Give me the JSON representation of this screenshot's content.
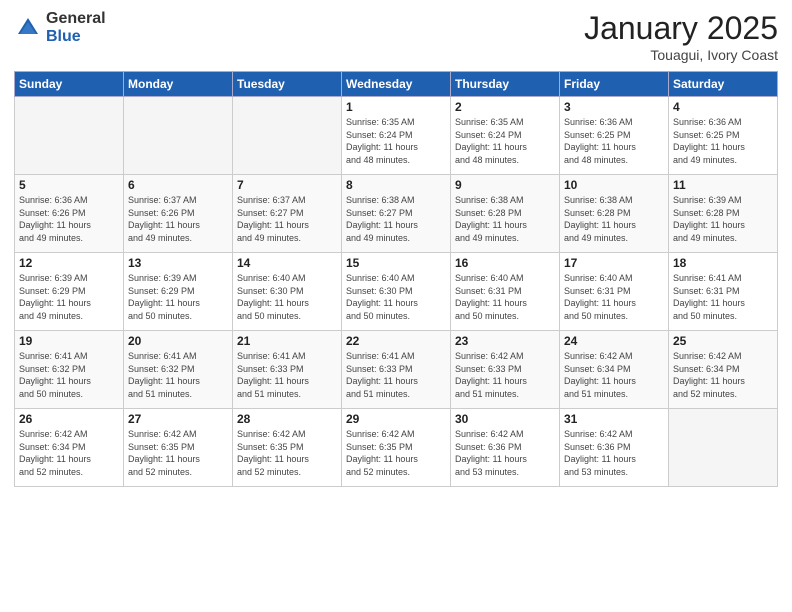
{
  "logo": {
    "general": "General",
    "blue": "Blue"
  },
  "header": {
    "month": "January 2025",
    "location": "Touagui, Ivory Coast"
  },
  "weekdays": [
    "Sunday",
    "Monday",
    "Tuesday",
    "Wednesday",
    "Thursday",
    "Friday",
    "Saturday"
  ],
  "weeks": [
    [
      {
        "day": "",
        "info": ""
      },
      {
        "day": "",
        "info": ""
      },
      {
        "day": "",
        "info": ""
      },
      {
        "day": "1",
        "info": "Sunrise: 6:35 AM\nSunset: 6:24 PM\nDaylight: 11 hours\nand 48 minutes."
      },
      {
        "day": "2",
        "info": "Sunrise: 6:35 AM\nSunset: 6:24 PM\nDaylight: 11 hours\nand 48 minutes."
      },
      {
        "day": "3",
        "info": "Sunrise: 6:36 AM\nSunset: 6:25 PM\nDaylight: 11 hours\nand 48 minutes."
      },
      {
        "day": "4",
        "info": "Sunrise: 6:36 AM\nSunset: 6:25 PM\nDaylight: 11 hours\nand 49 minutes."
      }
    ],
    [
      {
        "day": "5",
        "info": "Sunrise: 6:36 AM\nSunset: 6:26 PM\nDaylight: 11 hours\nand 49 minutes."
      },
      {
        "day": "6",
        "info": "Sunrise: 6:37 AM\nSunset: 6:26 PM\nDaylight: 11 hours\nand 49 minutes."
      },
      {
        "day": "7",
        "info": "Sunrise: 6:37 AM\nSunset: 6:27 PM\nDaylight: 11 hours\nand 49 minutes."
      },
      {
        "day": "8",
        "info": "Sunrise: 6:38 AM\nSunset: 6:27 PM\nDaylight: 11 hours\nand 49 minutes."
      },
      {
        "day": "9",
        "info": "Sunrise: 6:38 AM\nSunset: 6:28 PM\nDaylight: 11 hours\nand 49 minutes."
      },
      {
        "day": "10",
        "info": "Sunrise: 6:38 AM\nSunset: 6:28 PM\nDaylight: 11 hours\nand 49 minutes."
      },
      {
        "day": "11",
        "info": "Sunrise: 6:39 AM\nSunset: 6:28 PM\nDaylight: 11 hours\nand 49 minutes."
      }
    ],
    [
      {
        "day": "12",
        "info": "Sunrise: 6:39 AM\nSunset: 6:29 PM\nDaylight: 11 hours\nand 49 minutes."
      },
      {
        "day": "13",
        "info": "Sunrise: 6:39 AM\nSunset: 6:29 PM\nDaylight: 11 hours\nand 50 minutes."
      },
      {
        "day": "14",
        "info": "Sunrise: 6:40 AM\nSunset: 6:30 PM\nDaylight: 11 hours\nand 50 minutes."
      },
      {
        "day": "15",
        "info": "Sunrise: 6:40 AM\nSunset: 6:30 PM\nDaylight: 11 hours\nand 50 minutes."
      },
      {
        "day": "16",
        "info": "Sunrise: 6:40 AM\nSunset: 6:31 PM\nDaylight: 11 hours\nand 50 minutes."
      },
      {
        "day": "17",
        "info": "Sunrise: 6:40 AM\nSunset: 6:31 PM\nDaylight: 11 hours\nand 50 minutes."
      },
      {
        "day": "18",
        "info": "Sunrise: 6:41 AM\nSunset: 6:31 PM\nDaylight: 11 hours\nand 50 minutes."
      }
    ],
    [
      {
        "day": "19",
        "info": "Sunrise: 6:41 AM\nSunset: 6:32 PM\nDaylight: 11 hours\nand 50 minutes."
      },
      {
        "day": "20",
        "info": "Sunrise: 6:41 AM\nSunset: 6:32 PM\nDaylight: 11 hours\nand 51 minutes."
      },
      {
        "day": "21",
        "info": "Sunrise: 6:41 AM\nSunset: 6:33 PM\nDaylight: 11 hours\nand 51 minutes."
      },
      {
        "day": "22",
        "info": "Sunrise: 6:41 AM\nSunset: 6:33 PM\nDaylight: 11 hours\nand 51 minutes."
      },
      {
        "day": "23",
        "info": "Sunrise: 6:42 AM\nSunset: 6:33 PM\nDaylight: 11 hours\nand 51 minutes."
      },
      {
        "day": "24",
        "info": "Sunrise: 6:42 AM\nSunset: 6:34 PM\nDaylight: 11 hours\nand 51 minutes."
      },
      {
        "day": "25",
        "info": "Sunrise: 6:42 AM\nSunset: 6:34 PM\nDaylight: 11 hours\nand 52 minutes."
      }
    ],
    [
      {
        "day": "26",
        "info": "Sunrise: 6:42 AM\nSunset: 6:34 PM\nDaylight: 11 hours\nand 52 minutes."
      },
      {
        "day": "27",
        "info": "Sunrise: 6:42 AM\nSunset: 6:35 PM\nDaylight: 11 hours\nand 52 minutes."
      },
      {
        "day": "28",
        "info": "Sunrise: 6:42 AM\nSunset: 6:35 PM\nDaylight: 11 hours\nand 52 minutes."
      },
      {
        "day": "29",
        "info": "Sunrise: 6:42 AM\nSunset: 6:35 PM\nDaylight: 11 hours\nand 52 minutes."
      },
      {
        "day": "30",
        "info": "Sunrise: 6:42 AM\nSunset: 6:36 PM\nDaylight: 11 hours\nand 53 minutes."
      },
      {
        "day": "31",
        "info": "Sunrise: 6:42 AM\nSunset: 6:36 PM\nDaylight: 11 hours\nand 53 minutes."
      },
      {
        "day": "",
        "info": ""
      }
    ]
  ]
}
